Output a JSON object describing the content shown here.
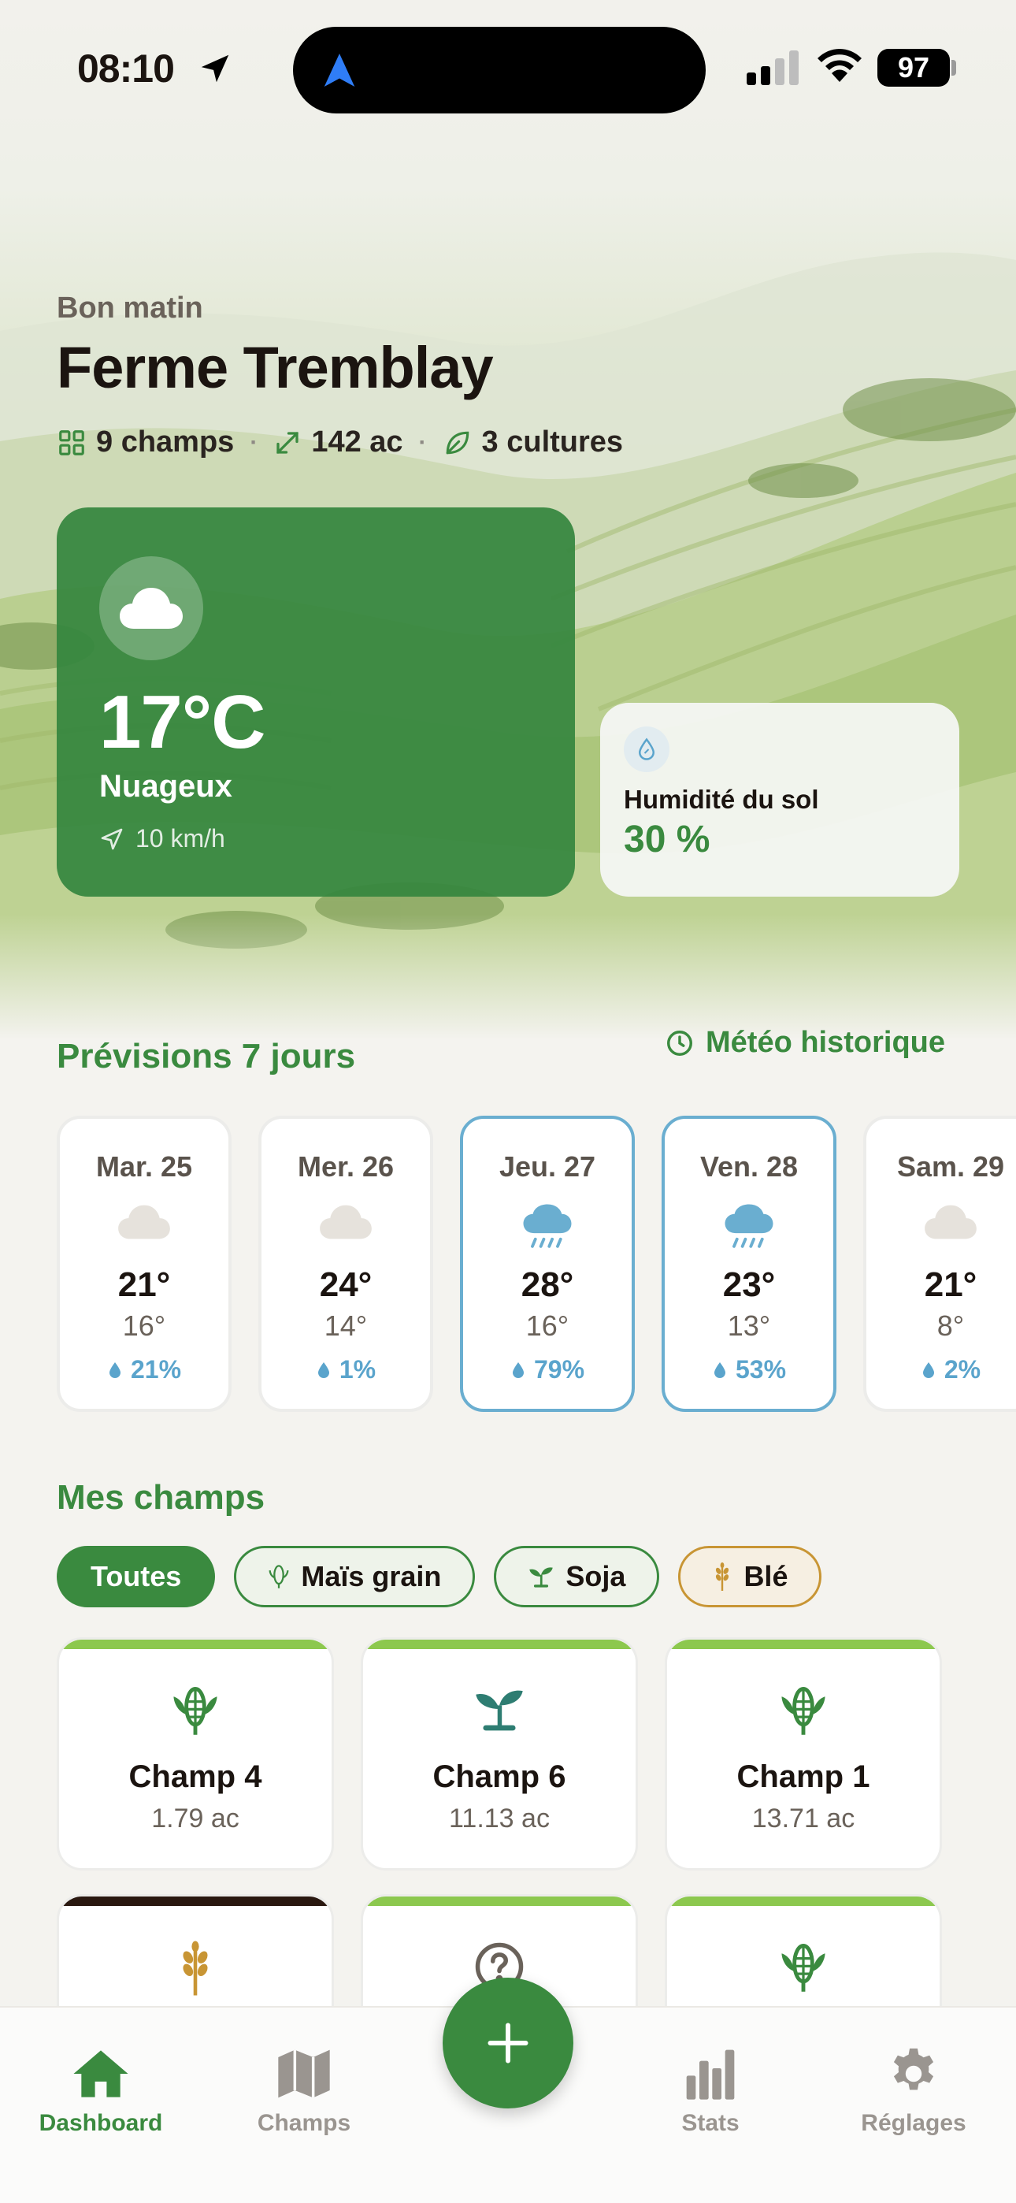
{
  "status_bar": {
    "time": "08:10",
    "battery": "97"
  },
  "header": {
    "greeting": "Bon matin",
    "farm_name": "Ferme Tremblay",
    "stats": {
      "fields": "9 champs",
      "area": "142 ac",
      "crops": "3 cultures"
    }
  },
  "weather": {
    "temperature": "17°C",
    "condition": "Nuageux",
    "wind": "10 km/h",
    "icon": "cloud-icon"
  },
  "soil": {
    "label": "Humidité du sol",
    "value": "30 %"
  },
  "forecast": {
    "title": "Prévisions 7 jours",
    "history_link": "Météo historique",
    "days": [
      {
        "name": "Mar. 25",
        "hi": "21°",
        "lo": "16°",
        "pop": "21%",
        "icon": "cloud-icon"
      },
      {
        "name": "Mer. 26",
        "hi": "24°",
        "lo": "14°",
        "pop": "1%",
        "icon": "cloud-icon"
      },
      {
        "name": "Jeu. 27",
        "hi": "28°",
        "lo": "16°",
        "pop": "79%",
        "icon": "rain-cloud-icon"
      },
      {
        "name": "Ven. 28",
        "hi": "23°",
        "lo": "13°",
        "pop": "53%",
        "icon": "rain-cloud-icon"
      },
      {
        "name": "Sam. 29",
        "hi": "21°",
        "lo": "8°",
        "pop": "2%",
        "icon": "cloud-icon"
      }
    ]
  },
  "fields": {
    "title": "Mes champs",
    "filters": [
      "Toutes",
      "Maïs grain",
      "Soja",
      "Blé"
    ],
    "cards": [
      {
        "name": "Champ 4",
        "area": "1.79 ac",
        "icon": "corn-icon"
      },
      {
        "name": "Champ 6",
        "area": "11.13 ac",
        "icon": "sprout-icon"
      },
      {
        "name": "Champ 1",
        "area": "13.71 ac",
        "icon": "corn-icon"
      },
      {
        "name": "",
        "area": "",
        "icon": "wheat-icon"
      },
      {
        "name": "",
        "area": "",
        "icon": "question-icon"
      },
      {
        "name": "",
        "area": "",
        "icon": "corn-icon"
      }
    ]
  },
  "tabbar": {
    "dashboard": "Dashboard",
    "fields": "Champs",
    "stats": "Stats",
    "settings": "Réglages"
  },
  "colors": {
    "accent": "#3a8a3f",
    "rain_border": "#6aaed0",
    "wheat": "#c89534",
    "field_bar": "#8cc84e"
  }
}
